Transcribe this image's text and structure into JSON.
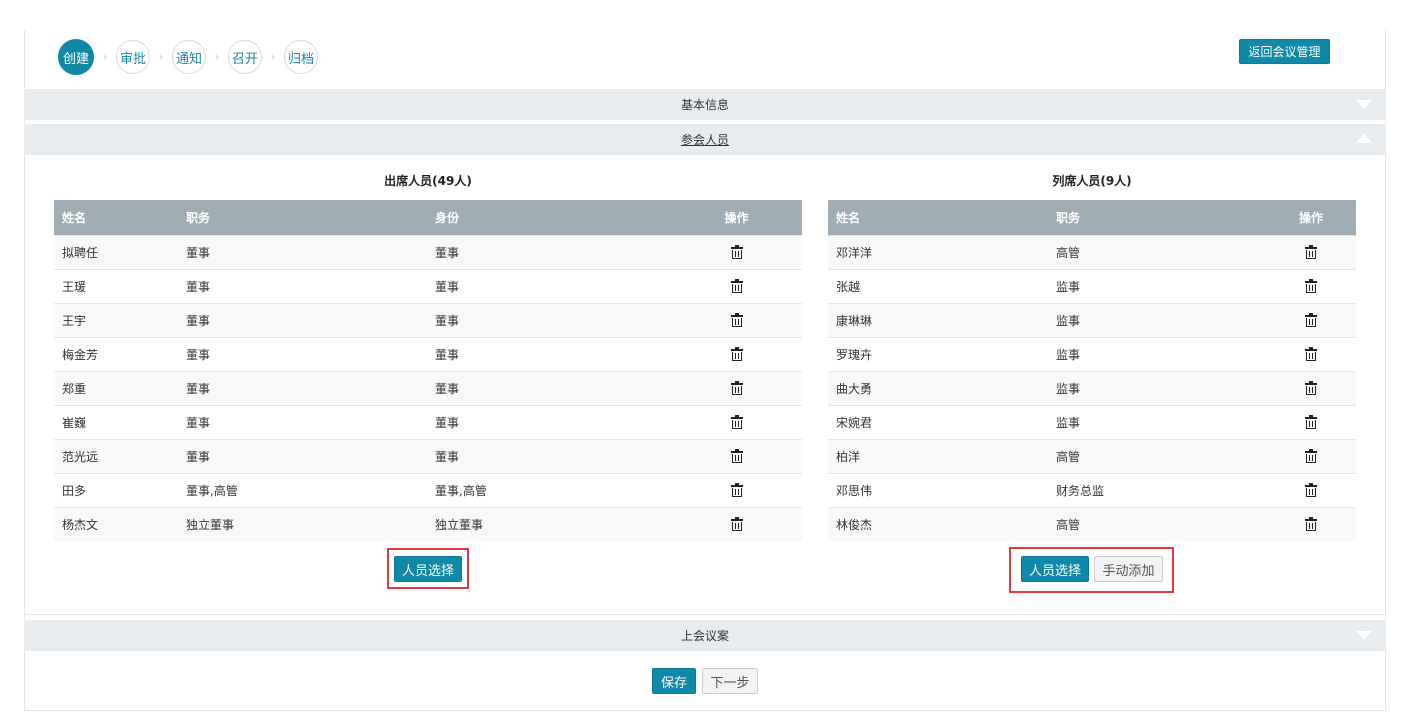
{
  "steps": [
    "创建",
    "审批",
    "通知",
    "召开",
    "归档"
  ],
  "step_separator": "›",
  "back_button": "返回会议管理",
  "sections": {
    "basic_info": "基本信息",
    "participants": "参会人员",
    "agenda": "上会议案"
  },
  "attendees": {
    "title": "出席人员(49人)",
    "columns": [
      "姓名",
      "职务",
      "身份",
      "操作"
    ],
    "rows": [
      {
        "name": "拟聘任",
        "post": "董事",
        "identity": "董事"
      },
      {
        "name": "王瑗",
        "post": "董事",
        "identity": "董事"
      },
      {
        "name": "王宇",
        "post": "董事",
        "identity": "董事"
      },
      {
        "name": "梅金芳",
        "post": "董事",
        "identity": "董事"
      },
      {
        "name": "郑重",
        "post": "董事",
        "identity": "董事"
      },
      {
        "name": "崔巍",
        "post": "董事",
        "identity": "董事"
      },
      {
        "name": "范光远",
        "post": "董事",
        "identity": "董事"
      },
      {
        "name": "田多",
        "post": "董事,高管",
        "identity": "董事,高管"
      },
      {
        "name": "杨杰文",
        "post": "独立董事",
        "identity": "独立董事"
      }
    ],
    "select_button": "人员选择"
  },
  "observers": {
    "title": "列席人员(9人)",
    "columns": [
      "姓名",
      "职务",
      "操作"
    ],
    "rows": [
      {
        "name": "邓洋洋",
        "post": "高管"
      },
      {
        "name": "张越",
        "post": "监事"
      },
      {
        "name": "康琳琳",
        "post": "监事"
      },
      {
        "name": "罗瑰卉",
        "post": "监事"
      },
      {
        "name": "曲大勇",
        "post": "监事"
      },
      {
        "name": "宋婉君",
        "post": "监事"
      },
      {
        "name": "柏洋",
        "post": "高管"
      },
      {
        "name": "邓思伟",
        "post": "财务总监"
      },
      {
        "name": "林俊杰",
        "post": "高管"
      }
    ],
    "select_button": "人员选择",
    "manual_add_button": "手动添加"
  },
  "footer": {
    "save_button": "保存",
    "next_button": "下一步"
  },
  "colors": {
    "primary": "#1089a8",
    "table_header": "#a1adb5",
    "section_bar": "#e8ecef",
    "highlight": "#e23a3a"
  }
}
